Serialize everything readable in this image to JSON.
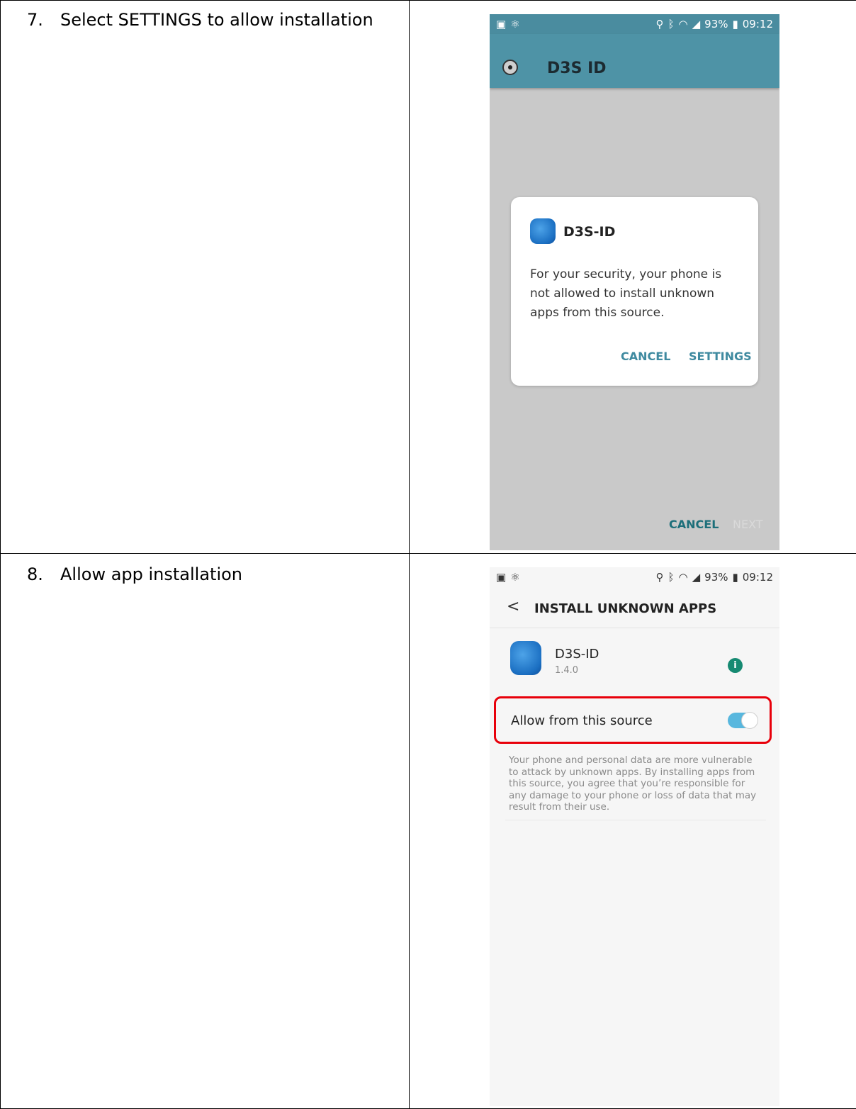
{
  "steps": [
    {
      "number": "7.",
      "text": "Select SETTINGS to allow installation"
    },
    {
      "number": "8.",
      "text": "Allow app installation"
    }
  ],
  "status_bar": {
    "left_icons": [
      "gallery-icon",
      "atom-icon"
    ],
    "right_icons": [
      "location-icon",
      "bluetooth-icon",
      "wifi-icon",
      "signal-icon"
    ],
    "battery": "93%",
    "time": "09:12"
  },
  "screen1": {
    "app_bar_title": "D3S ID",
    "dialog": {
      "app_name": "D3S-ID",
      "message": "For your security, your phone is not allowed to install unknown apps from this source.",
      "cancel_label": "CANCEL",
      "settings_label": "SETTINGS"
    },
    "bottom": {
      "cancel_label": "CANCEL",
      "next_label": "NEXT"
    },
    "colors": {
      "appbar": "#4e93a6",
      "accent": "#3f8aa0",
      "next_disabled": "#d9d9d9",
      "cancel": "#1d6f7a"
    }
  },
  "screen2": {
    "title": "INSTALL UNKNOWN APPS",
    "app_name": "D3S-ID",
    "app_version": "1.4.0",
    "allow_label": "Allow from this source",
    "allow_enabled": true,
    "warning": "Your phone and personal data are more vulnerable to attack by unknown apps. By installing apps from this source, you agree that you’re responsible for any damage to your phone or loss of data that may result from their use.",
    "colors": {
      "highlight": "#e8000b",
      "toggle_on": "#58b7de",
      "info": "#168a72"
    }
  }
}
